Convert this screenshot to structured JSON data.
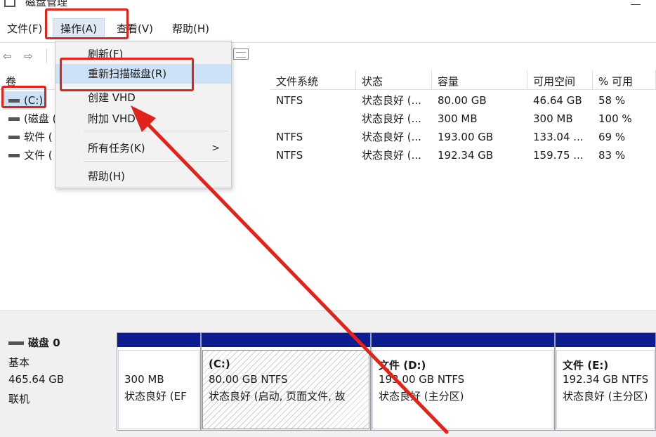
{
  "window": {
    "title": "磁盘管理"
  },
  "menubar": {
    "file": "文件(F)",
    "action": "操作(A)",
    "view": "查看(V)",
    "help": "帮助(H)"
  },
  "context_menu": {
    "refresh": "刷新(F)",
    "rescan": "重新扫描磁盘(R)",
    "create_vhd": "创建 VHD",
    "attach_vhd": "附加 VHD",
    "all_tasks": "所有任务(K)",
    "all_tasks_chevron": ">",
    "help": "帮助(H)"
  },
  "table": {
    "headers": {
      "volume": "卷",
      "filesystem": "文件系统",
      "status": "状态",
      "capacity": "容量",
      "free": "可用空间",
      "pct_free": "% 可用"
    },
    "rows": [
      {
        "name": "(C:)",
        "filesystem": "NTFS",
        "status": "状态良好 (...",
        "capacity": "80.00 GB",
        "free": "46.64 GB",
        "pct": "58 %"
      },
      {
        "name": "(磁盘 (",
        "filesystem": "",
        "status": "状态良好 (...",
        "capacity": "300 MB",
        "free": "300 MB",
        "pct": "100 %"
      },
      {
        "name": "软件 (",
        "filesystem": "NTFS",
        "status": "状态良好 (...",
        "capacity": "193.00 GB",
        "free": "133.04 ...",
        "pct": "69 %"
      },
      {
        "name": "文件 (",
        "filesystem": "NTFS",
        "status": "状态良好 (...",
        "capacity": "192.34 GB",
        "free": "159.75 ...",
        "pct": "83 %"
      }
    ]
  },
  "disk0": {
    "label": "磁盘 0",
    "type": "基本",
    "size": "465.64 GB",
    "status": "联机",
    "partitions": [
      {
        "name": "",
        "size": "300 MB",
        "status": "状态良好 (EF"
      },
      {
        "name": "(C:)",
        "size": "80.00 GB NTFS",
        "status": "状态良好 (启动, 页面文件, 故"
      },
      {
        "name": "文件  (D:)",
        "size": "193.00 GB NTFS",
        "status": "状态良好 (主分区)"
      },
      {
        "name": "文件  (E:)",
        "size": "192.34 GB NTFS",
        "status": "状态良好 (主分区)"
      }
    ]
  },
  "colors": {
    "highlight": "#e2231a",
    "partition_band": "#0d1c8f",
    "selection": "#cde1f7"
  }
}
